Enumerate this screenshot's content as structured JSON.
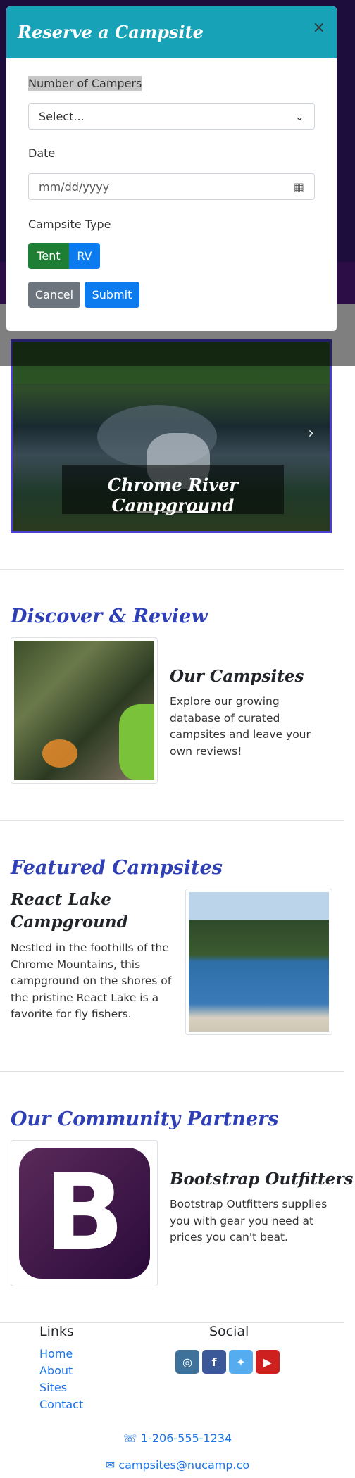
{
  "carousel": {
    "caption": "Chrome River Campground",
    "slide_count": 3,
    "active_index": 2
  },
  "discover": {
    "title": "Discover & Review",
    "card_title": "Our Campsites",
    "card_text": "Explore our growing database of curated campsites and leave your own reviews!"
  },
  "featured": {
    "title": "Featured Campsites",
    "card_title": "React Lake Campground",
    "card_text": "Nestled in the foothills of the Chrome Mountains, this campground on the shores of the pristine React Lake is a favorite for fly fishers."
  },
  "partners": {
    "title": "Our Community Partners",
    "card_title": "Bootstrap Outfitters",
    "card_text": "Bootstrap Outfitters supplies you with gear you need at prices you can't beat.",
    "logo_letter": "B"
  },
  "footer": {
    "links_heading": "Links",
    "links": [
      "Home",
      "About",
      "Sites",
      "Contact"
    ],
    "social_heading": "Social",
    "social": [
      {
        "name": "instagram-icon",
        "glyph": "◎",
        "color": "#3f729b"
      },
      {
        "name": "facebook-icon",
        "glyph": "f",
        "color": "#3b5998"
      },
      {
        "name": "twitter-icon",
        "glyph": "✦",
        "color": "#55acee"
      },
      {
        "name": "youtube-icon",
        "glyph": "▶",
        "color": "#cd201f"
      }
    ],
    "phone": "1-206-555-1234",
    "email": "campsites@nucamp.co"
  },
  "modal": {
    "title": "Reserve a Campsite",
    "close_glyph": "×",
    "campers_label": "Number of Campers",
    "campers_value": "Select...",
    "date_label": "Date",
    "date_placeholder": "mm/dd/yyyy",
    "type_label": "Campsite Type",
    "type_options": [
      "Tent",
      "RV"
    ],
    "cancel_label": "Cancel",
    "submit_label": "Submit"
  },
  "colors": {
    "header_teal": "#17a2b8",
    "tent_green": "#1e7e34",
    "rv_blue": "#0d7bf0",
    "cancel_gray": "#6c757d",
    "submit_blue": "#0d7bf0",
    "section_title_blue": "#2f3fb5"
  }
}
